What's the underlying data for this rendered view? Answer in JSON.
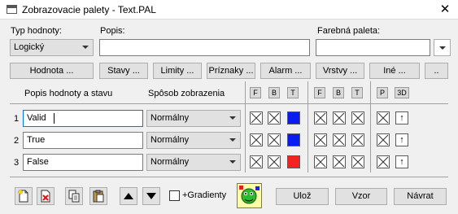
{
  "window": {
    "title": "Zobrazovacie palety - Text.PAL",
    "close": "✕"
  },
  "fields": {
    "type_label": "Typ hodnoty:",
    "type_value": "Logický",
    "desc_label": "Popis:",
    "desc_value": "",
    "palette_label": "Farebná paleta:",
    "palette_value": ""
  },
  "buttons_row": [
    "Hodnota ...",
    "Stavy ...",
    "Limity ...",
    "Príznaky ...",
    "Alarm ...",
    "Vrstvy ...",
    "Iné ...",
    ".."
  ],
  "table": {
    "col_desc": "Popis hodnoty a stavu",
    "col_mode": "Spôsob zobrazenia",
    "group1": [
      "F",
      "B",
      "T"
    ],
    "group2": [
      "F",
      "B",
      "T"
    ],
    "group3": [
      "P",
      "3D"
    ],
    "rows": [
      {
        "num": "1",
        "value": "Valid",
        "mode": "Normálny",
        "color": "#0a1df0"
      },
      {
        "num": "2",
        "value": "True",
        "mode": "Normálny",
        "color": "#0a1df0"
      },
      {
        "num": "3",
        "value": "False",
        "mode": "Normálny",
        "color": "#f52222"
      }
    ],
    "arrow_glyph": "↑"
  },
  "bottom": {
    "gradient_label": "+Gradienty",
    "save": "Ulož",
    "template": "Vzor",
    "back": "Návrat"
  },
  "icons": {
    "tool_new": "new-document-icon",
    "tool_delete": "delete-icon",
    "tool_copy": "copy-icon",
    "tool_paste": "paste-icon",
    "move_up": "triangle-up-icon",
    "move_down": "triangle-down-icon"
  }
}
